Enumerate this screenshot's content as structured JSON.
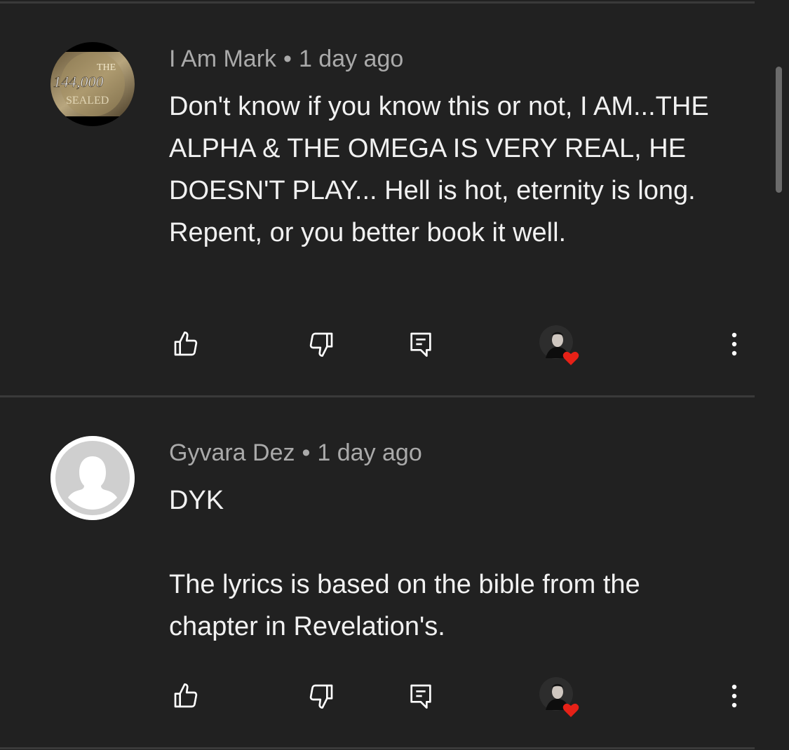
{
  "comments": [
    {
      "author": "I Am Mark",
      "separator": "•",
      "time": "1 day ago",
      "text": "Don't know if you know this or not, I AM...THE ALPHA & THE OMEGA IS VERY REAL, HE DOESN'T PLAY... Hell is hot, eternity is long. Repent, or you better book it well.",
      "avatar_text": [
        "THE",
        "144,000",
        "SEALED"
      ],
      "icons": [
        "thumb-up-icon",
        "thumb-down-icon",
        "reply-icon",
        "creator-heart-icon",
        "more-vert-icon"
      ]
    },
    {
      "author": "Gyvara Dez",
      "separator": "•",
      "time": "1 day ago",
      "text": "DYK\n\nThe lyrics is based on the bible from the chapter in Revelation's.",
      "icons": [
        "thumb-up-icon",
        "thumb-down-icon",
        "reply-icon",
        "creator-heart-icon",
        "more-vert-icon"
      ]
    }
  ],
  "colors": {
    "background": "#212121",
    "text": "#f1f1f1",
    "meta": "#aaaaaa",
    "divider": "#3a3a3a",
    "heart": "#e62117"
  }
}
